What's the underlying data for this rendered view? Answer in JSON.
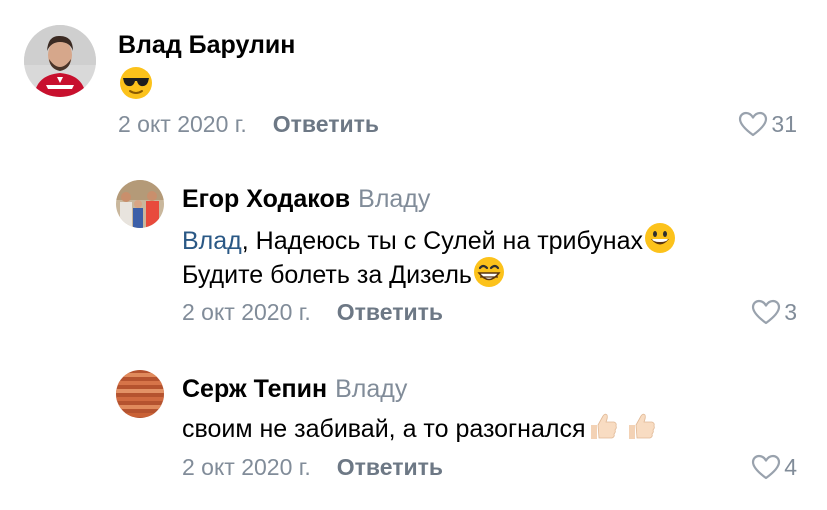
{
  "comments": [
    {
      "author": "Влад Барулин",
      "reply_to": "",
      "lines": [],
      "emoji": "sunglasses-emoji",
      "date": "2 окт 2020 г.",
      "reply_label": "Ответить",
      "likes": "31"
    },
    {
      "author": "Егор Ходаков",
      "reply_to": "Владу",
      "mention": "Влад",
      "line1_rest": ", Надеюсь ты с Сулей на трибунах",
      "line2": "Будите болеть за Дизель",
      "date": "2 окт 2020 г.",
      "reply_label": "Ответить",
      "likes": "3"
    },
    {
      "author": "Серж Тепин",
      "reply_to": "Владу",
      "line1": "своим не забивай, а то разогнался",
      "date": "2 окт 2020 г.",
      "reply_label": "Ответить",
      "likes": "4"
    }
  ],
  "colors": {
    "muted": "#818c99",
    "link": "#2a5885",
    "reply_button": "#6d7885"
  }
}
